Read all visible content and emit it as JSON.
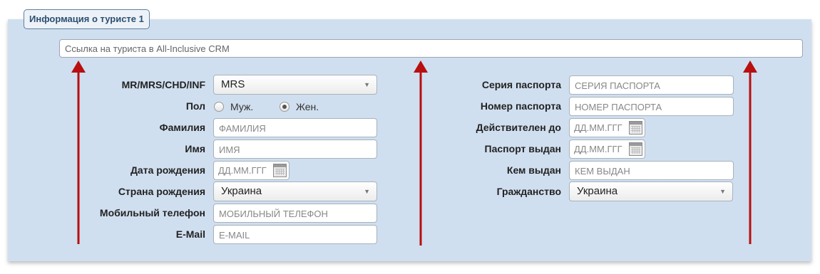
{
  "section": {
    "title": "Информация о туристе 1",
    "crm_link_placeholder": "Ссылка на туриста в All-Inclusive CRM"
  },
  "left_form": {
    "title_label": "MR/MRS/CHD/INF",
    "title_value": "MRS",
    "gender_label": "Пол",
    "gender_male": "Муж.",
    "gender_female": "Жен.",
    "gender_selected": "Жен.",
    "lastname_label": "Фамилия",
    "lastname_placeholder": "ФАМИЛИЯ",
    "firstname_label": "Имя",
    "firstname_placeholder": "ИМЯ",
    "birthdate_label": "Дата рождения",
    "birthdate_placeholder": "ДД.ММ.ГГГГ",
    "birth_country_label": "Страна рождения",
    "birth_country_value": "Украина",
    "phone_label": "Мобильный телефон",
    "phone_placeholder": "МОБИЛЬНЫЙ ТЕЛЕФОН",
    "email_label": "E-Mail",
    "email_placeholder": "E-MAIL"
  },
  "right_form": {
    "passport_series_label": "Серия паспорта",
    "passport_series_placeholder": "СЕРИЯ ПАСПОРТА",
    "passport_number_label": "Номер паспорта",
    "passport_number_placeholder": "НОМЕР ПАСПОРТА",
    "valid_until_label": "Действителен до",
    "valid_until_placeholder": "ДД.ММ.ГГГГ",
    "issued_date_label": "Паспорт выдан",
    "issued_date_placeholder": "ДД.ММ.ГГГГ",
    "issued_by_label": "Кем выдан",
    "issued_by_placeholder": "КЕМ ВЫДАН",
    "citizenship_label": "Гражданство",
    "citizenship_value": "Украина"
  },
  "icons": {
    "select_caret": "▼",
    "calendar": "calendar-icon",
    "arrow": "up-arrow-icon"
  },
  "colors": {
    "panel_background": "#d0dfef",
    "legend_text": "#2d4f70",
    "arrow": "#b80f0f"
  }
}
